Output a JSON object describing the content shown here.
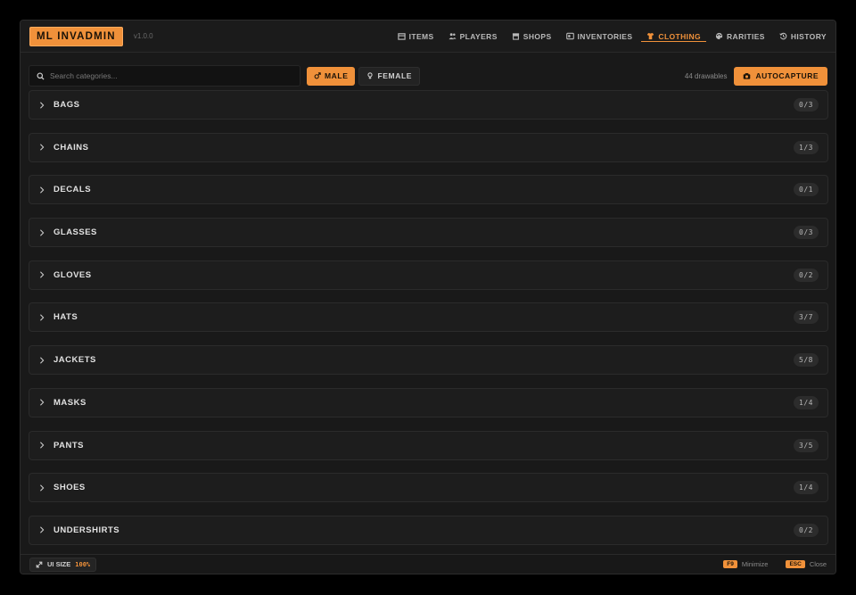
{
  "app": {
    "logo": "ML INVADMIN",
    "version": "v1.0.0"
  },
  "nav": [
    {
      "label": "ITEMS",
      "icon": "box-icon"
    },
    {
      "label": "PLAYERS",
      "icon": "users-icon"
    },
    {
      "label": "SHOPS",
      "icon": "store-icon"
    },
    {
      "label": "INVENTORIES",
      "icon": "inventory-icon"
    },
    {
      "label": "CLOTHING",
      "icon": "shirt-icon",
      "active": true
    },
    {
      "label": "RARITIES",
      "icon": "palette-icon"
    },
    {
      "label": "HISTORY",
      "icon": "history-icon"
    }
  ],
  "toolbar": {
    "search_placeholder": "Search categories...",
    "male_label": "MALE",
    "female_label": "FEMALE",
    "selected_gender": "male",
    "drawables_count": "44 drawables",
    "autocapture_label": "AUTOCAPTURE"
  },
  "categories": [
    {
      "name": "BAGS",
      "count": "0/3"
    },
    {
      "name": "CHAINS",
      "count": "1/3"
    },
    {
      "name": "DECALS",
      "count": "0/1"
    },
    {
      "name": "GLASSES",
      "count": "0/3"
    },
    {
      "name": "GLOVES",
      "count": "0/2"
    },
    {
      "name": "HATS",
      "count": "3/7"
    },
    {
      "name": "JACKETS",
      "count": "5/8"
    },
    {
      "name": "MASKS",
      "count": "1/4"
    },
    {
      "name": "PANTS",
      "count": "3/5"
    },
    {
      "name": "SHOES",
      "count": "1/4"
    },
    {
      "name": "UNDERSHIRTS",
      "count": "0/2"
    }
  ],
  "footer": {
    "ui_size_label": "UI SIZE",
    "ui_size_value": "100%",
    "minimize_key": "F9",
    "minimize_label": "Minimize",
    "close_key": "ESC",
    "close_label": "Close"
  },
  "colors": {
    "accent": "#f0913a",
    "background": "#191919"
  }
}
